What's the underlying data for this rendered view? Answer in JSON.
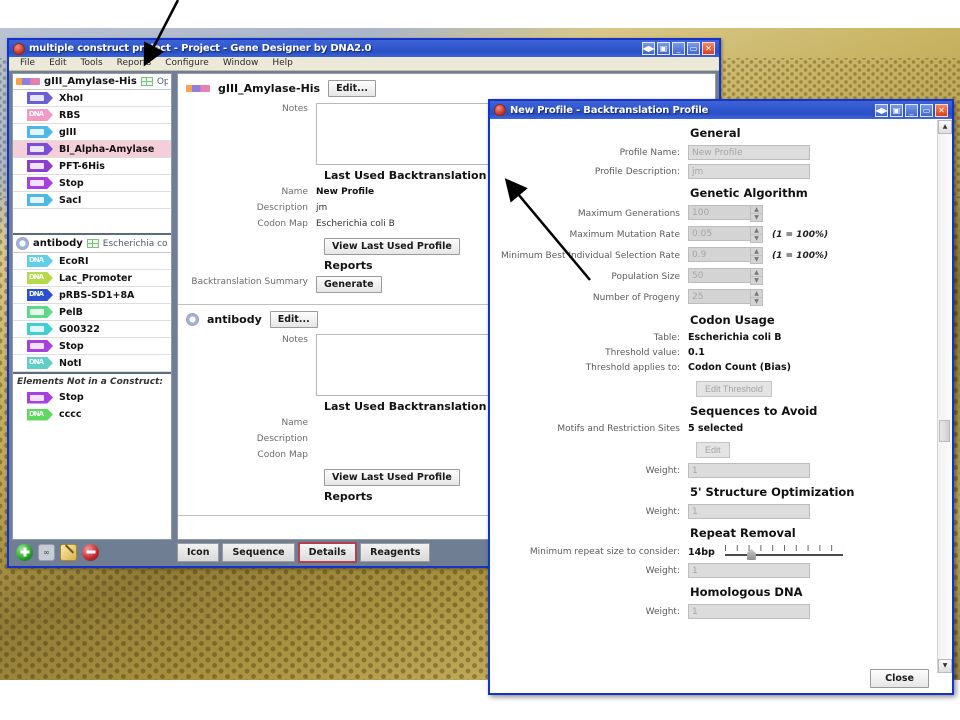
{
  "main_window": {
    "title": "multiple construct project - Project - Gene Designer by DNA2.0",
    "menu": [
      "File",
      "Edit",
      "Tools",
      "Reports",
      "Configure",
      "Window",
      "Help"
    ],
    "window_buttons": [
      "◀▶",
      "▣",
      "_",
      "▭",
      "✕"
    ]
  },
  "sidebar": {
    "constructs": [
      {
        "name": "gIII_Amylase-His",
        "organism": "OptC",
        "icon": "linear-construct-icon",
        "elements": [
          {
            "label": "XhoI",
            "type": "cds",
            "color": "#6a5fd6",
            "selected": false
          },
          {
            "label": "RBS",
            "type": "dna",
            "color": "#f19ac4",
            "selected": false
          },
          {
            "label": "gIII",
            "type": "cds",
            "color": "#4db9e8",
            "selected": false
          },
          {
            "label": "BI_Alpha-Amylase",
            "type": "cds",
            "color": "#7a4fd6",
            "selected": true
          },
          {
            "label": "PFT-6His",
            "type": "cds",
            "color": "#8a3fd0",
            "selected": false
          },
          {
            "label": "Stop",
            "type": "cds",
            "color": "#a93fe0",
            "selected": false
          },
          {
            "label": "SacI",
            "type": "cds",
            "color": "#4db9e8",
            "selected": false
          }
        ]
      },
      {
        "name": "antibody",
        "organism": "Escherichia coli B",
        "icon": "circular-construct-icon",
        "elements": [
          {
            "label": "EcoRI",
            "type": "dna",
            "color": "#5fd0e8",
            "selected": false
          },
          {
            "label": "Lac_Promoter",
            "type": "dna",
            "color": "#b5d94a",
            "selected": false
          },
          {
            "label": "pRBS-SD1+8A",
            "type": "dna",
            "color": "#2b4fd0",
            "selected": false
          },
          {
            "label": "PelB",
            "type": "cds",
            "color": "#5fd88a",
            "selected": false
          },
          {
            "label": "G00322",
            "type": "cds",
            "color": "#3fd0d0",
            "selected": false
          },
          {
            "label": "Stop",
            "type": "cds",
            "color": "#a93fe0",
            "selected": false
          },
          {
            "label": "NotI",
            "type": "dna",
            "color": "#5fd0c8",
            "selected": false
          }
        ]
      }
    ],
    "not_in_construct": {
      "header": "Elements Not in a Construct:",
      "elements": [
        {
          "label": "Stop",
          "type": "cds",
          "color": "#a93fe0"
        },
        {
          "label": "cccc",
          "type": "dna",
          "color": "#5fd85f"
        }
      ]
    },
    "toolbar": {
      "add_label": "add-element",
      "link_label": "∞",
      "edit_label": "edit-element",
      "remove_label": "remove-element"
    }
  },
  "details": {
    "cards": [
      {
        "title": "gIII_Amylase-His",
        "edit_button": "Edit...",
        "notes_label": "Notes",
        "notes_value": "",
        "profile_heading": "Last Used Backtranslation Profile",
        "fields": [
          {
            "label": "Name",
            "value": "New Profile"
          },
          {
            "label": "Description",
            "value": "jm"
          },
          {
            "label": "Codon Map",
            "value": "Escherichia coli B"
          }
        ],
        "view_profile_button": "View Last Used Profile",
        "reports_heading": "Reports",
        "report_label": "Backtranslation Summary",
        "report_button": "Generate"
      },
      {
        "title": "antibody",
        "edit_button": "Edit...",
        "notes_label": "Notes",
        "notes_value": "",
        "profile_heading": "Last Used Backtranslation Profile",
        "fields": [
          {
            "label": "Name",
            "value": ""
          },
          {
            "label": "Description",
            "value": ""
          },
          {
            "label": "Codon Map",
            "value": ""
          }
        ],
        "view_profile_button": "View Last Used Profile",
        "reports_heading": "Reports",
        "report_label": "",
        "report_button": ""
      }
    ],
    "tabs": [
      {
        "label": "Icon",
        "active": false
      },
      {
        "label": "Sequence",
        "active": false
      },
      {
        "label": "Details",
        "active": true
      },
      {
        "label": "Reagents",
        "active": false
      }
    ]
  },
  "dialog": {
    "title": "New Profile - Backtranslation Profile",
    "window_buttons": [
      "◀▶",
      "▣",
      "_",
      "▭",
      "✕"
    ],
    "sections": {
      "general": {
        "heading": "General",
        "fields": [
          {
            "label": "Profile Name:",
            "value": "New Profile"
          },
          {
            "label": "Profile Description:",
            "value": "jm"
          }
        ]
      },
      "genetic_algorithm": {
        "heading": "Genetic Algorithm",
        "fields": [
          {
            "label": "Maximum Generations",
            "value": "100",
            "hint": ""
          },
          {
            "label": "Maximum Mutation Rate",
            "value": "0.05",
            "hint": "(1 = 100%)"
          },
          {
            "label": "Minimum Best Individual Selection Rate",
            "value": "0.9",
            "hint": "(1 = 100%)"
          },
          {
            "label": "Population Size",
            "value": "50",
            "hint": ""
          },
          {
            "label": "Number of Progeny",
            "value": "25",
            "hint": ""
          }
        ]
      },
      "codon_usage": {
        "heading": "Codon Usage",
        "fields": [
          {
            "label": "Table:",
            "value": "Escherichia coli B"
          },
          {
            "label": "Threshold value:",
            "value": "0.1"
          },
          {
            "label": "Threshold applies to:",
            "value": "Codon Count (Bias)"
          }
        ],
        "button": "Edit Threshold"
      },
      "sequences_to_avoid": {
        "heading": "Sequences to Avoid",
        "motifs_label": "Motifs and Restriction Sites",
        "motifs_value": "5 selected",
        "button": "Edit",
        "weight_label": "Weight:",
        "weight_value": "1"
      },
      "structure_optimization": {
        "heading": "5' Structure Optimization",
        "weight_label": "Weight:",
        "weight_value": "1"
      },
      "repeat_removal": {
        "heading": "Repeat Removal",
        "slider_label": "Minimum repeat size to consider:",
        "slider_value": "14bp",
        "weight_label": "Weight:",
        "weight_value": "1"
      },
      "homologous_dna": {
        "heading": "Homologous DNA",
        "weight_label": "Weight:",
        "weight_value": "1"
      }
    },
    "close_button": "Close"
  },
  "colors": {
    "titlebar_blue": "#2f57cd",
    "window_border": "#1433c8",
    "panel_bg": "#6f7e93",
    "selected_row": "#f5cfd8",
    "active_tab_border": "#b4404e"
  }
}
